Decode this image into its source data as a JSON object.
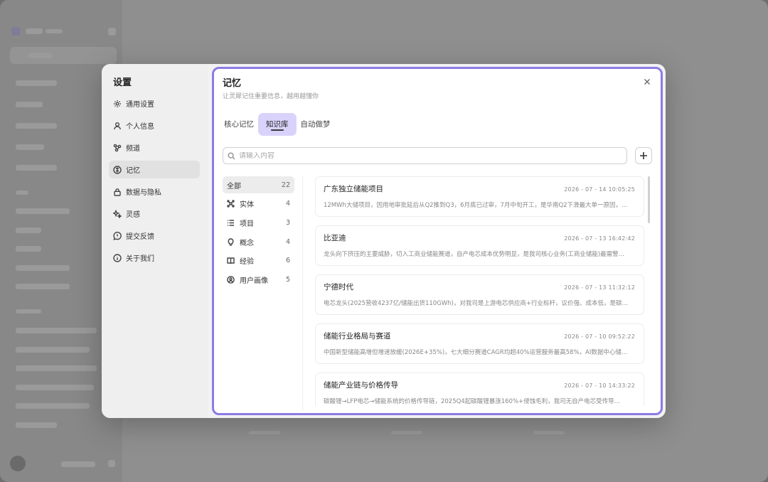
{
  "settings": {
    "title": "设置",
    "nav": [
      {
        "label": "通用设置",
        "icon": "gear-icon"
      },
      {
        "label": "个人信息",
        "icon": "user-icon"
      },
      {
        "label": "频道",
        "icon": "channel-icon"
      },
      {
        "label": "记忆",
        "icon": "memory-icon",
        "active": true
      },
      {
        "label": "数据与隐私",
        "icon": "lock-icon"
      },
      {
        "label": "灵感",
        "icon": "sparkle-icon"
      },
      {
        "label": "提交反馈",
        "icon": "feedback-icon"
      },
      {
        "label": "关于我们",
        "icon": "info-icon"
      }
    ]
  },
  "memory": {
    "title": "记忆",
    "subtitle": "让灵犀记住重要信息，越用越懂你",
    "tabs": [
      {
        "label": "核心记忆",
        "active": false
      },
      {
        "label": "知识库",
        "active": true
      },
      {
        "label": "自动做梦",
        "active": false
      }
    ],
    "search": {
      "placeholder": "请输入内容"
    },
    "categories": [
      {
        "label": "全部",
        "count": "22",
        "icon": "",
        "active": true
      },
      {
        "label": "实体",
        "count": "4",
        "icon": "entity-icon"
      },
      {
        "label": "项目",
        "count": "3",
        "icon": "list-icon"
      },
      {
        "label": "概念",
        "count": "4",
        "icon": "bulb-icon"
      },
      {
        "label": "经验",
        "count": "6",
        "icon": "book-icon"
      },
      {
        "label": "用户画像",
        "count": "5",
        "icon": "user-circle-icon"
      }
    ],
    "items": [
      {
        "title": "广东独立储能项目",
        "time": "2026 - 07 - 14    10:05:25",
        "desc": "12MWh大储项目，因用地审批延后从Q2推到Q3，6月底已过审，7月中旬开工，是华南Q2下滑最大单一原因，…"
      },
      {
        "title": "比亚迪",
        "time": "2026 - 07 - 13    16:42:42",
        "desc": "龙头向下挤压的主要威胁，切入工商业储能赛道，自产电芯成本优势明显，是我司核心业务(工商业储能)最需警…"
      },
      {
        "title": "宁德时代",
        "time": "2026 - 07 - 13    11:32:12",
        "desc": "电芯龙头(2025营收4237亿/储能出货110GWh)，对我司是上游电芯供应商+行业标杆，议价强、成本低，是碳…"
      },
      {
        "title": "储能行业格局与赛道",
        "time": "2026 - 07 - 10    09:52:22",
        "desc": "中国新型储能高增但增速放缓(2026E+35%)，七大细分赛道CAGR均超40%运营服务最高58%，AI数据中心储…"
      },
      {
        "title": "储能产业链与价格传导",
        "time": "2026 - 07 - 10    14:33:22",
        "desc": "碳酸锂→LFP电芯→储能系统的价格传导链，2025Q4起碳酸锂暴涨160%+侵蚀毛利，我司无自产电芯受传导…"
      }
    ]
  }
}
